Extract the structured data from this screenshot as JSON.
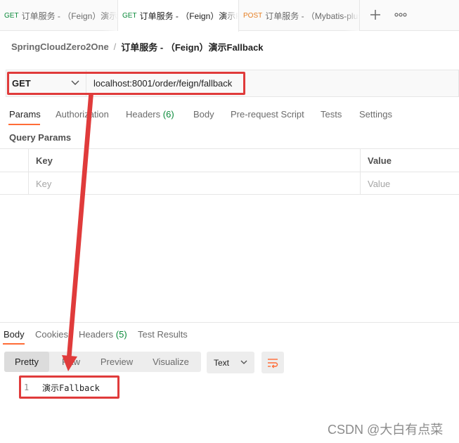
{
  "tabs": [
    {
      "method": "GET",
      "method_color": "#0b8a3a",
      "name": "订单服务 - （Feign）演示F"
    },
    {
      "method": "GET",
      "method_color": "#0b8a3a",
      "name": "订单服务 - （Feign）演示F"
    },
    {
      "method": "POST",
      "method_color": "#e67e22",
      "name": "订单服务 - （Mybatis-plus"
    }
  ],
  "tab_actions": {
    "new_tab_icon": "plus-icon",
    "more_icon": "more-horizontal-icon"
  },
  "breadcrumb": {
    "collection": "SpringCloudZero2One",
    "separator": "/",
    "request": "订单服务 - （Feign）演示Fallback"
  },
  "request": {
    "method": "GET",
    "url": "localhost:8001/order/feign/fallback"
  },
  "request_tabs": [
    {
      "label": "Params",
      "count": ""
    },
    {
      "label": "Authorization",
      "count": ""
    },
    {
      "label": "Headers",
      "count": "(6)"
    },
    {
      "label": "Body",
      "count": ""
    },
    {
      "label": "Pre-request Script",
      "count": ""
    },
    {
      "label": "Tests",
      "count": ""
    },
    {
      "label": "Settings",
      "count": ""
    }
  ],
  "query_params": {
    "title": "Query Params",
    "columns": [
      "Key",
      "Value"
    ],
    "placeholder_row": [
      "Key",
      "Value"
    ]
  },
  "response_tabs": [
    {
      "label": "Body",
      "count": ""
    },
    {
      "label": "Cookies",
      "count": ""
    },
    {
      "label": "Headers",
      "count": "(5)"
    },
    {
      "label": "Test Results",
      "count": ""
    }
  ],
  "response_view": {
    "modes": [
      "Pretty",
      "Raw",
      "Preview",
      "Visualize"
    ],
    "active_mode": "Pretty",
    "format": "Text",
    "wrap_icon": "wrap-lines-icon"
  },
  "response_body": {
    "line_number": "1",
    "text": "演示Fallback"
  },
  "annotation_color": "#e03b3b",
  "accent_color": "#ff6c37",
  "watermark": "CSDN @大白有点菜"
}
